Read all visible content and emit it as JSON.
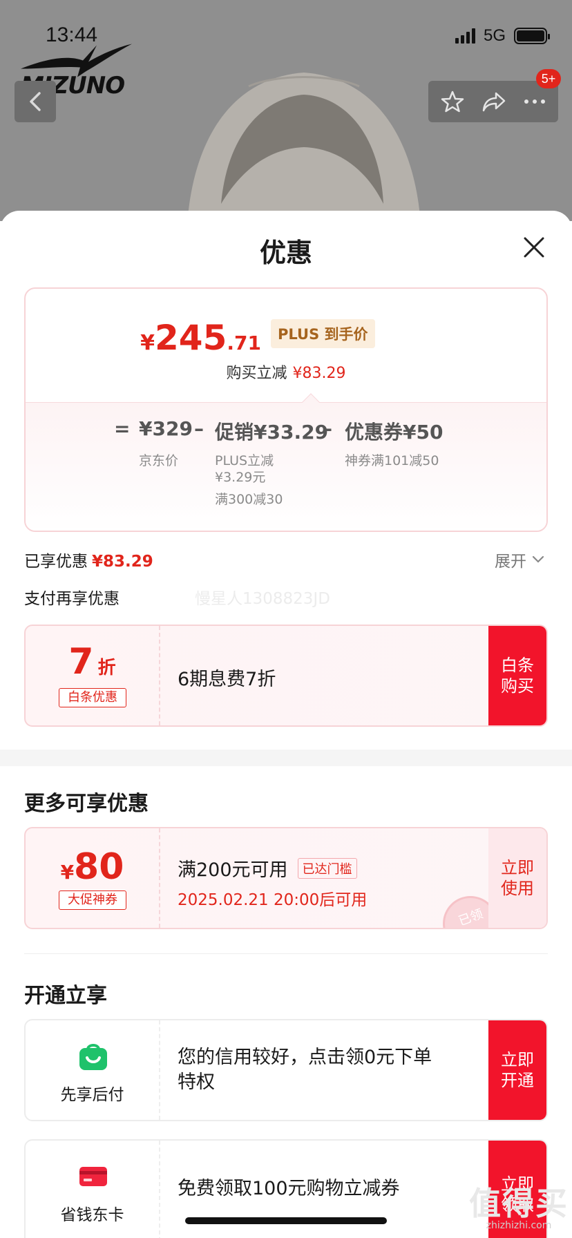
{
  "status_bar": {
    "time": "13:44",
    "network": "5G"
  },
  "brand": {
    "logo_text": "MIZUNO"
  },
  "header": {
    "badge": "5+"
  },
  "sheet": {
    "title": "优惠"
  },
  "price_card": {
    "yen": "¥",
    "price_int": "245",
    "price_dec": ".71",
    "plus_tag": "PLUS 到手价",
    "reduce_label": "购买立减",
    "reduce_value": "¥83.29",
    "equals": "=",
    "jd_price": "¥329",
    "jd_price_label": "京东价",
    "minus1": "–",
    "promo": "促销¥33.29",
    "promo_detail_1": "PLUS立减",
    "promo_detail_2": "¥3.29元",
    "promo_detail_3": "满300减30",
    "minus2": "–",
    "coupon": "优惠券¥50",
    "coupon_detail": "神券满101减50"
  },
  "saved": {
    "label": "已享优惠",
    "value": "¥83.29",
    "expand": "展开"
  },
  "pay_section": {
    "title": "支付再享优惠",
    "watermark": "慢星人1308823JD"
  },
  "baitiao_card": {
    "discount": "7",
    "discount_unit": "折",
    "tag": "白条优惠",
    "desc": "6期息费7折",
    "cta_line1": "白条",
    "cta_line2": "购买"
  },
  "more_section": {
    "title": "更多可享优惠"
  },
  "coupon_card": {
    "yen": "¥",
    "amount": "80",
    "tag": "大促神券",
    "condition": "满200元可用",
    "threshold_tag": "已达门槛",
    "valid_from": "2025.02.21 20:00后可用",
    "stamp": "已领",
    "cta_line1": "立即",
    "cta_line2": "使用"
  },
  "open_section": {
    "title": "开通立享"
  },
  "priv_cards": [
    {
      "label": "先享后付",
      "text_line1": "您的信用较好，点击领0元下单",
      "text_line2": "特权",
      "cta_line1": "立即",
      "cta_line2": "开通"
    },
    {
      "label": "省钱东卡",
      "text_line1": "免费领取100元购物立减券",
      "cta_line1": "立即",
      "cta_line2": "领取"
    }
  ],
  "site_mark": {
    "big": "值得买",
    "small": "zhizhizhi.com"
  },
  "colors": {
    "accent": "#e1251b",
    "cta": "#f2142b",
    "plus_tag_bg": "#fbeedd",
    "plus_tag_fg": "#a6641e"
  }
}
